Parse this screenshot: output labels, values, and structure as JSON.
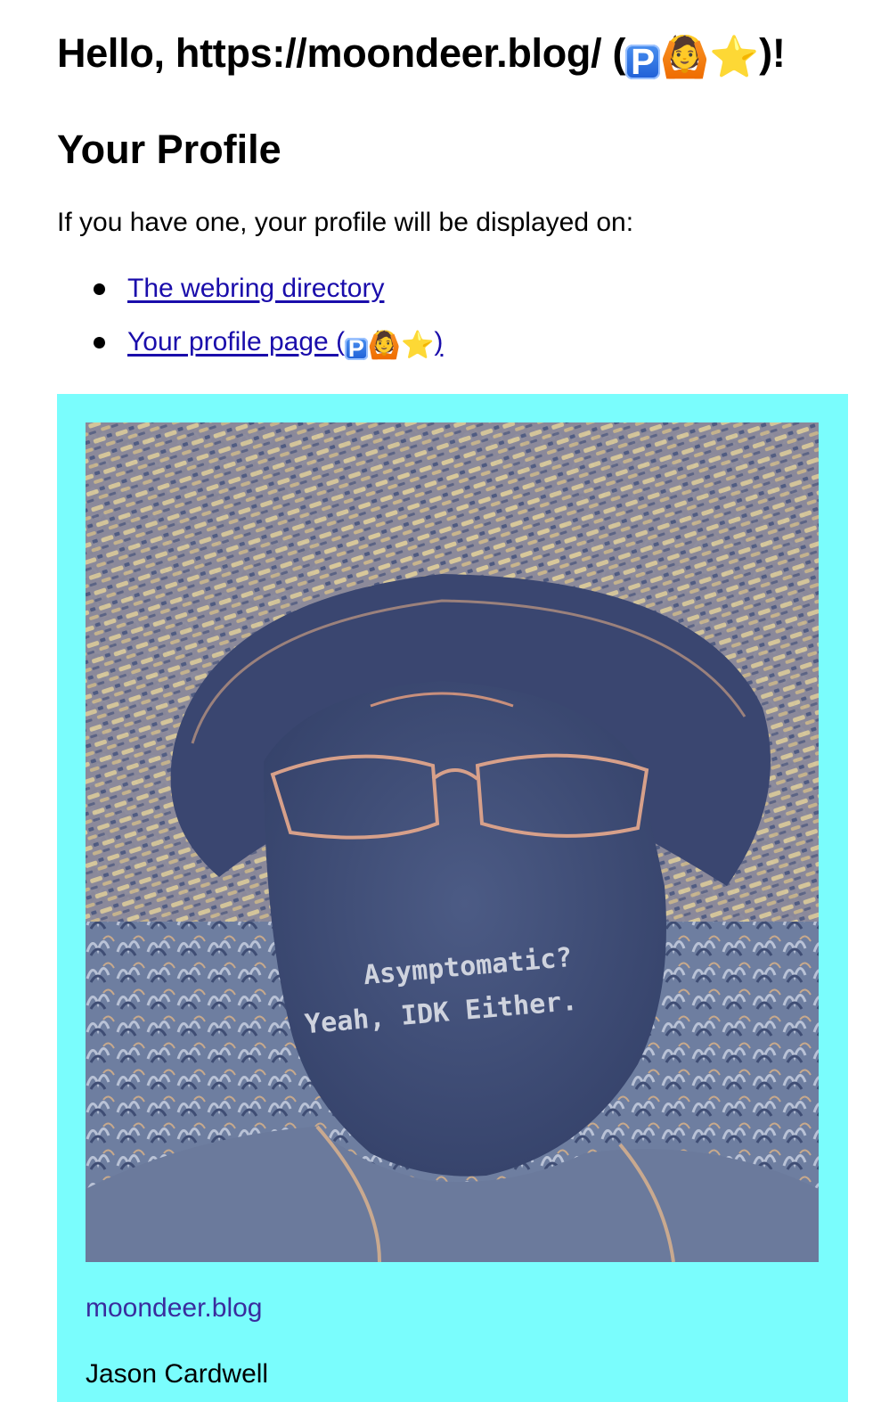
{
  "greeting": {
    "prefix": "Hello, https://moondeer.blog/ (",
    "suffix": ")!",
    "emoji_icons": [
      "p-button-icon",
      "person-gesturing-ok-icon",
      "star-icon"
    ]
  },
  "profile": {
    "heading": "Your Profile",
    "intro": "If you have one, your profile will be displayed on:",
    "links": [
      {
        "label": "The webring directory"
      },
      {
        "label_prefix": "Your profile page (",
        "label_suffix": ")"
      }
    ]
  },
  "card": {
    "background": "#7afdfd",
    "photo_caption": "Asymptomatic? Yeah, IDK Either.",
    "site": "moondeer.blog",
    "name": "Jason Cardwell"
  },
  "colors": {
    "link": "#1a0dab",
    "site_link": "#3a2c9e"
  }
}
